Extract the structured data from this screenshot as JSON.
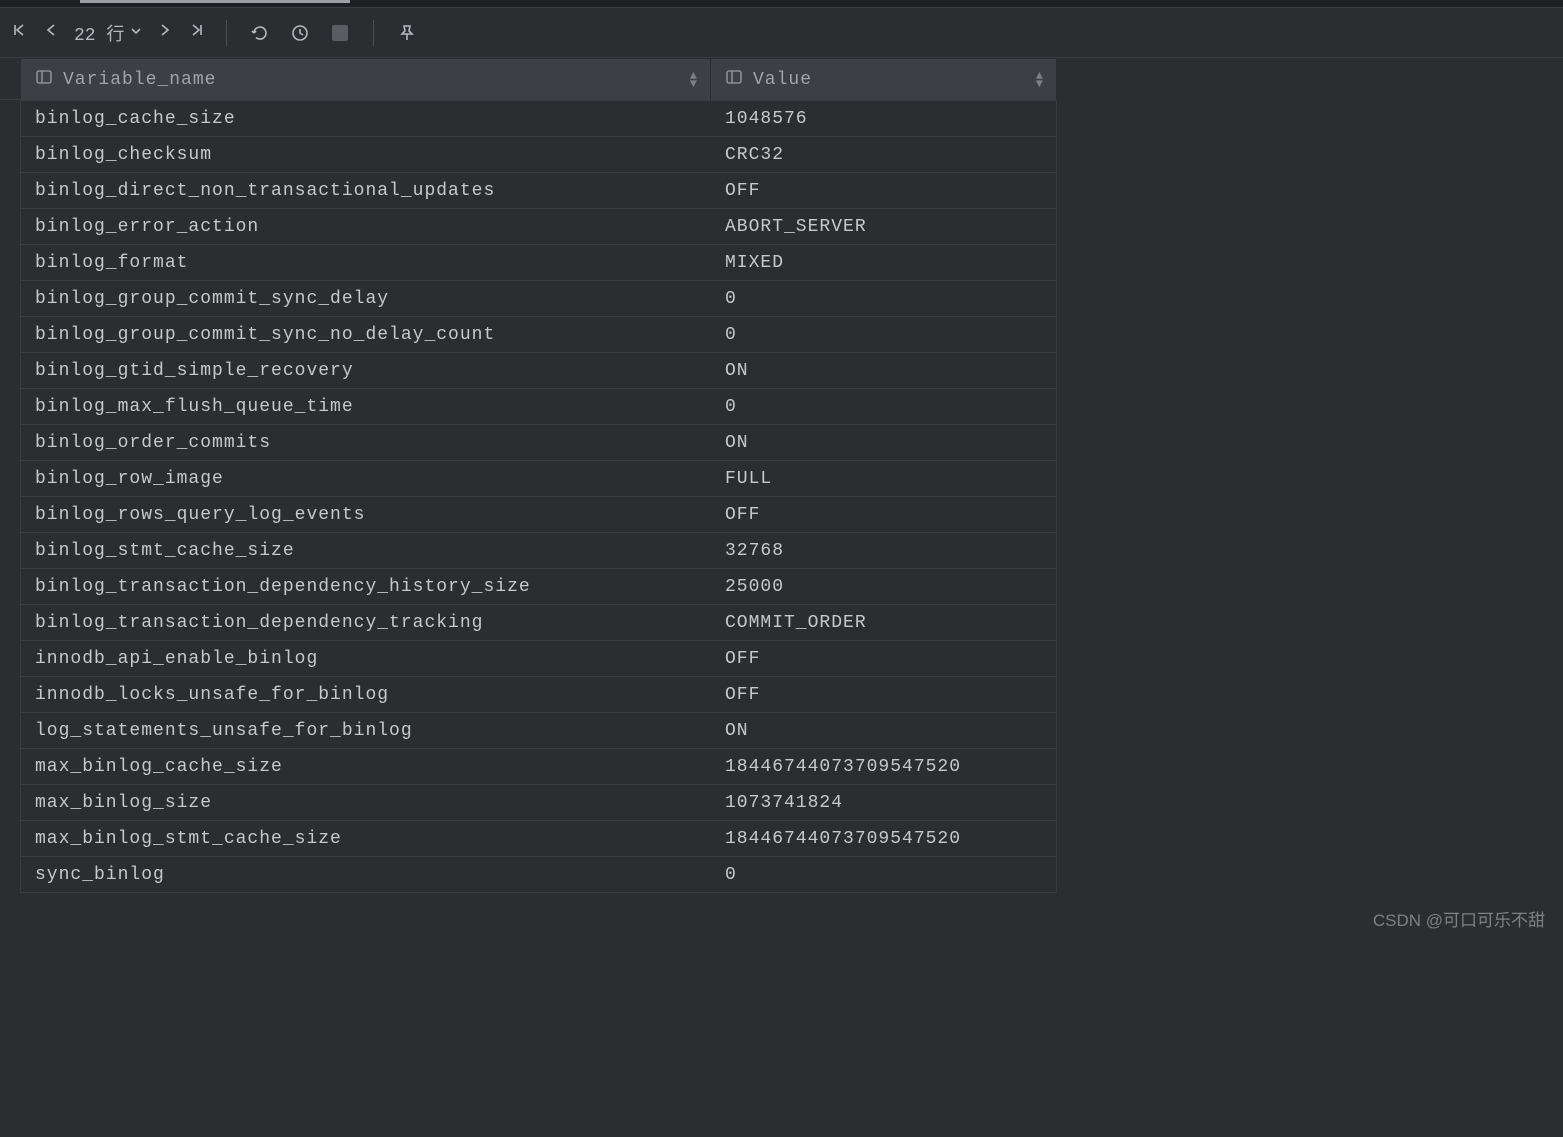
{
  "toolbar": {
    "row_count_label": "22 行"
  },
  "columns": {
    "name": "Variable_name",
    "value": "Value"
  },
  "rows": [
    {
      "name": "binlog_cache_size",
      "value": "1048576"
    },
    {
      "name": "binlog_checksum",
      "value": "CRC32"
    },
    {
      "name": "binlog_direct_non_transactional_updates",
      "value": "OFF"
    },
    {
      "name": "binlog_error_action",
      "value": "ABORT_SERVER"
    },
    {
      "name": "binlog_format",
      "value": "MIXED"
    },
    {
      "name": "binlog_group_commit_sync_delay",
      "value": "0"
    },
    {
      "name": "binlog_group_commit_sync_no_delay_count",
      "value": "0"
    },
    {
      "name": "binlog_gtid_simple_recovery",
      "value": "ON"
    },
    {
      "name": "binlog_max_flush_queue_time",
      "value": "0"
    },
    {
      "name": "binlog_order_commits",
      "value": "ON"
    },
    {
      "name": "binlog_row_image",
      "value": "FULL"
    },
    {
      "name": "binlog_rows_query_log_events",
      "value": "OFF"
    },
    {
      "name": "binlog_stmt_cache_size",
      "value": "32768"
    },
    {
      "name": "binlog_transaction_dependency_history_size",
      "value": "25000"
    },
    {
      "name": "binlog_transaction_dependency_tracking",
      "value": "COMMIT_ORDER"
    },
    {
      "name": "innodb_api_enable_binlog",
      "value": "OFF"
    },
    {
      "name": "innodb_locks_unsafe_for_binlog",
      "value": "OFF"
    },
    {
      "name": "log_statements_unsafe_for_binlog",
      "value": "ON"
    },
    {
      "name": "max_binlog_cache_size",
      "value": "18446744073709547520"
    },
    {
      "name": "max_binlog_size",
      "value": "1073741824"
    },
    {
      "name": "max_binlog_stmt_cache_size",
      "value": "18446744073709547520"
    },
    {
      "name": "sync_binlog",
      "value": "0"
    }
  ],
  "watermark": "CSDN @可口可乐不甜"
}
